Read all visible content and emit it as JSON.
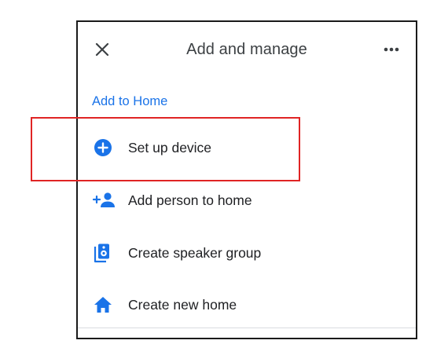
{
  "header": {
    "title": "Add and manage",
    "close_icon": "close-icon",
    "more_icon": "more-horiz-icon"
  },
  "section": {
    "label": "Add to Home"
  },
  "items": [
    {
      "label": "Set up device",
      "icon": "add-circle-icon"
    },
    {
      "label": "Add person to home",
      "icon": "person-add-icon"
    },
    {
      "label": "Create speaker group",
      "icon": "speaker-group-icon"
    },
    {
      "label": "Create new home",
      "icon": "home-icon"
    }
  ],
  "colors": {
    "accent": "#1a73e8",
    "text": "#202124",
    "title": "#3c4043",
    "highlight": "#e02424",
    "border": "#1a1a1a"
  }
}
